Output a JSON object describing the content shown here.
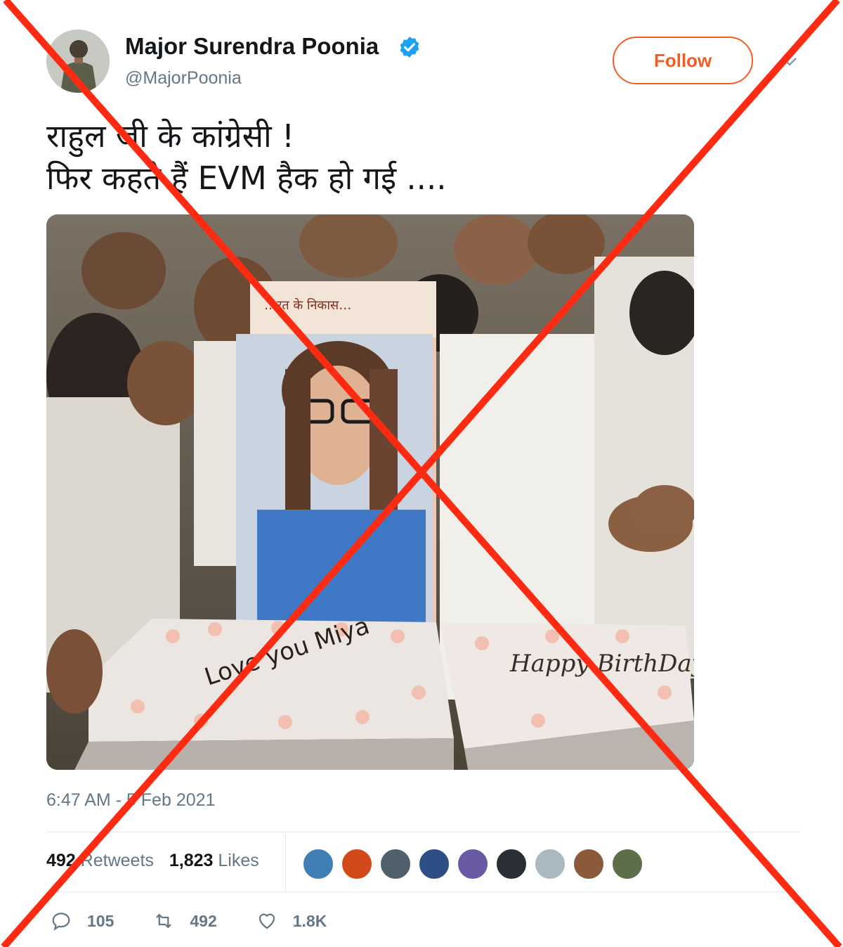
{
  "tweet": {
    "author_name": "Major Surendra Poonia",
    "handle": "@MajorPoonia",
    "verified": true,
    "follow_label": "Follow",
    "text": "राहुल जी के कांग्रेसी !\nफिर कहते हैं EVM हैक हो गई ....",
    "media": {
      "cake_text_left": "Love you Miya",
      "cake_text_right": "Happy BirthDay",
      "poster_text": "…रत के निकास…"
    },
    "timestamp": "6:47 AM - 5 Feb 2021",
    "retweets_count": "492",
    "retweets_label": "Retweets",
    "likes_count": "1,823",
    "likes_label": "Likes",
    "likers": [
      {
        "icon": "avatar-icon",
        "color": "#3f7fb5"
      },
      {
        "icon": "avatar-icon",
        "color": "#d24a1c"
      },
      {
        "icon": "avatar-icon",
        "color": "#50606a"
      },
      {
        "icon": "avatar-icon",
        "color": "#2d4f86"
      },
      {
        "icon": "avatar-icon",
        "color": "#6a5aa6"
      },
      {
        "icon": "avatar-icon",
        "color": "#2a2f35"
      },
      {
        "icon": "avatar-icon",
        "color": "#aab8c2"
      },
      {
        "icon": "avatar-icon",
        "color": "#8a5a3a"
      },
      {
        "icon": "avatar-icon",
        "color": "#5c6e4a"
      }
    ],
    "actions": {
      "reply_count": "105",
      "retweet_count": "492",
      "like_count": "1.8K"
    }
  },
  "overlay": {
    "type": "red-x-false-claim",
    "color": "#ff2a12"
  },
  "colors": {
    "follow": "#f45d22",
    "verified": "#1da1f2",
    "secondary_text": "#657786"
  }
}
